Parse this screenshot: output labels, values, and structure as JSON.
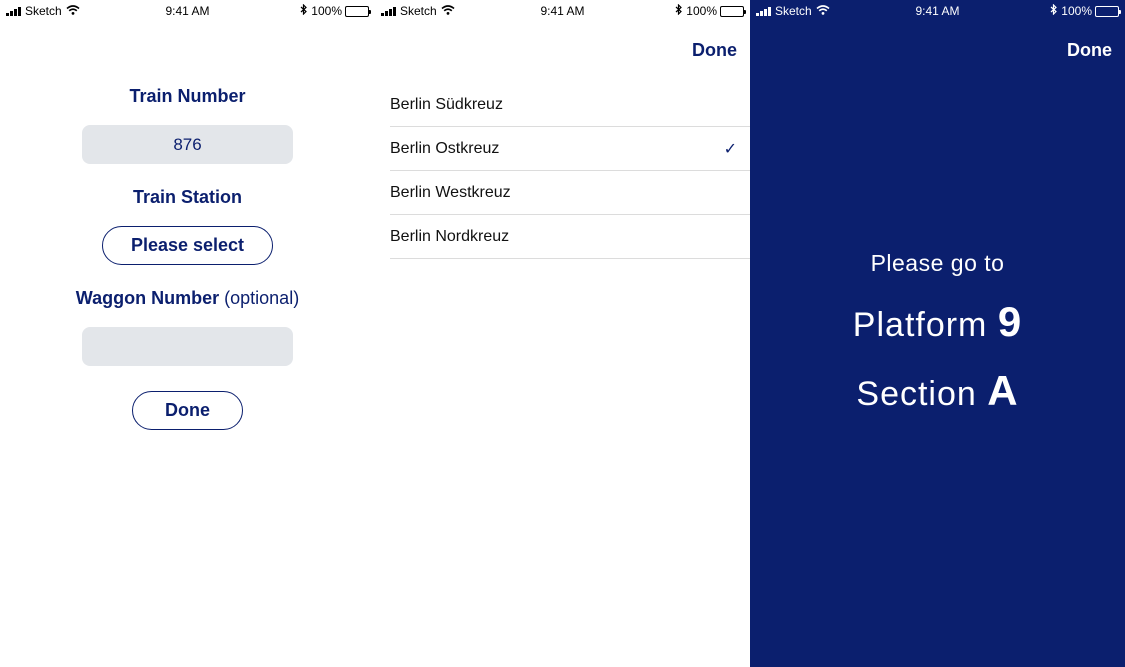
{
  "status_bar": {
    "carrier": "Sketch",
    "time": "9:41 AM",
    "battery": "100%"
  },
  "form_screen": {
    "train_number_label": "Train Number",
    "train_number_value": "876",
    "train_station_label": "Train Station",
    "station_button_label": "Please select",
    "waggon_label": "Waggon Number",
    "waggon_optional": "(optional)",
    "waggon_value": "",
    "done_button_label": "Done"
  },
  "station_picker": {
    "done_label": "Done",
    "stations": [
      {
        "name": "Berlin Südkreuz",
        "selected": false
      },
      {
        "name": "Berlin Ostkreuz",
        "selected": true
      },
      {
        "name": "Berlin Westkreuz",
        "selected": false
      },
      {
        "name": "Berlin Nordkreuz",
        "selected": false
      }
    ],
    "check_glyph": "✓"
  },
  "result_screen": {
    "done_label": "Done",
    "intro": "Please go to",
    "platform_label": "Platform",
    "platform_value": "9",
    "section_label": "Section",
    "section_value": "A",
    "background_color": "#0b1f6e"
  }
}
